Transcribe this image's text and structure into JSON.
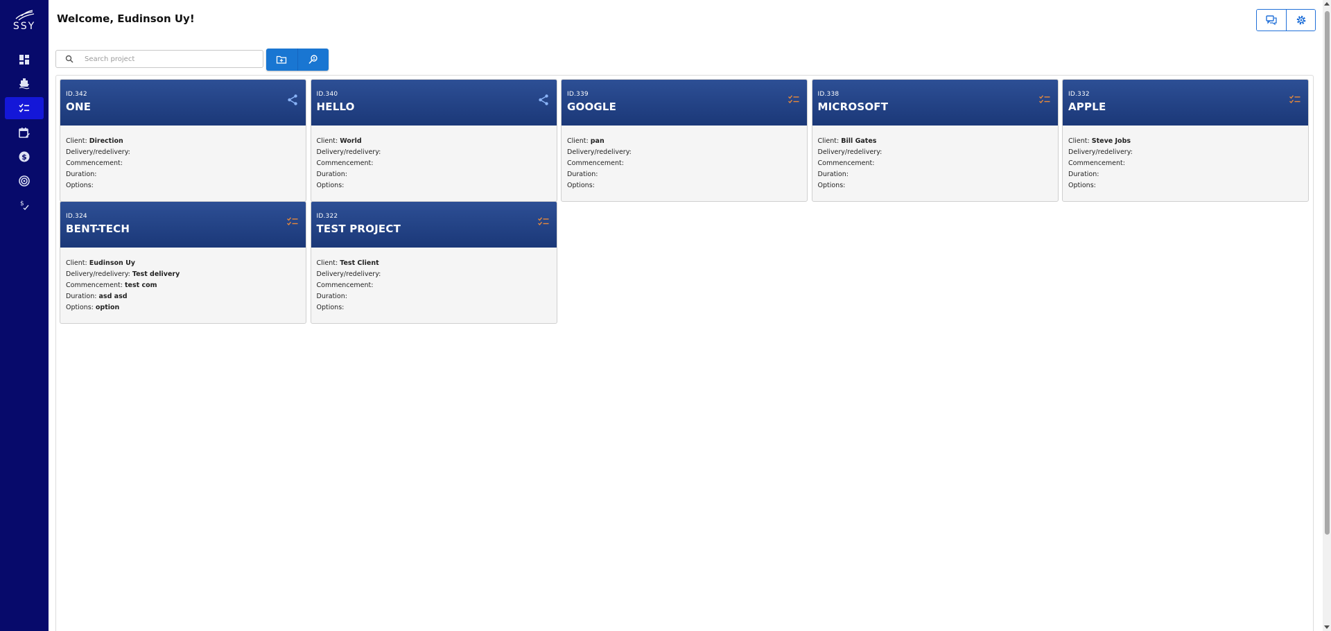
{
  "app": {
    "logo_text": "SSY"
  },
  "sidebar": {
    "items": [
      {
        "icon": "dashboard-icon",
        "active": false
      },
      {
        "icon": "ship-icon",
        "active": false
      },
      {
        "icon": "checklist-icon",
        "active": true
      },
      {
        "icon": "calendar-edit-icon",
        "active": false
      },
      {
        "icon": "dollar-icon",
        "active": false
      },
      {
        "icon": "target-icon",
        "active": false
      },
      {
        "icon": "dollar-check-icon",
        "active": false
      }
    ]
  },
  "header": {
    "welcome": "Welcome, Eudinson Uy!",
    "actions": [
      "chat-icon",
      "settings-icon"
    ]
  },
  "search": {
    "placeholder": "Search project",
    "value": ""
  },
  "labels": {
    "client": "Client:",
    "delivery": "Delivery/redelivery:",
    "commencement": "Commencement:",
    "duration": "Duration:",
    "options": "Options:"
  },
  "projects": [
    {
      "id": "ID.342",
      "name": "ONE",
      "icon": "share-icon",
      "client": "Direction",
      "delivery": "",
      "commencement": "",
      "duration": "",
      "options": ""
    },
    {
      "id": "ID.340",
      "name": "HELLO",
      "icon": "share-icon",
      "client": "World",
      "delivery": "",
      "commencement": "",
      "duration": "",
      "options": ""
    },
    {
      "id": "ID.339",
      "name": "GOOGLE",
      "icon": "checklist-icon",
      "client": "pan",
      "delivery": "",
      "commencement": "",
      "duration": "",
      "options": ""
    },
    {
      "id": "ID.338",
      "name": "MICROSOFT",
      "icon": "checklist-icon",
      "client": "Bill Gates",
      "delivery": "",
      "commencement": "",
      "duration": "",
      "options": ""
    },
    {
      "id": "ID.332",
      "name": "APPLE",
      "icon": "checklist-icon",
      "client": "Steve Jobs",
      "delivery": "",
      "commencement": "",
      "duration": "",
      "options": ""
    },
    {
      "id": "ID.324",
      "name": "BENT-TECH",
      "icon": "checklist-icon",
      "client": "Eudinson Uy",
      "delivery": "Test delivery",
      "commencement": "test com",
      "duration": "asd asd",
      "options": "option"
    },
    {
      "id": "ID.322",
      "name": "TEST PROJECT",
      "icon": "checklist-icon",
      "client": "Test Client",
      "delivery": "",
      "commencement": "",
      "duration": "",
      "options": ""
    }
  ],
  "colors": {
    "sidebar_bg": "#070a6b",
    "sidebar_active": "#1417d8",
    "card_header": "#1f3d82",
    "accent_blue": "#1976d2",
    "share_icon": "#8ab4f8",
    "checklist_icon": "#e8893a"
  }
}
